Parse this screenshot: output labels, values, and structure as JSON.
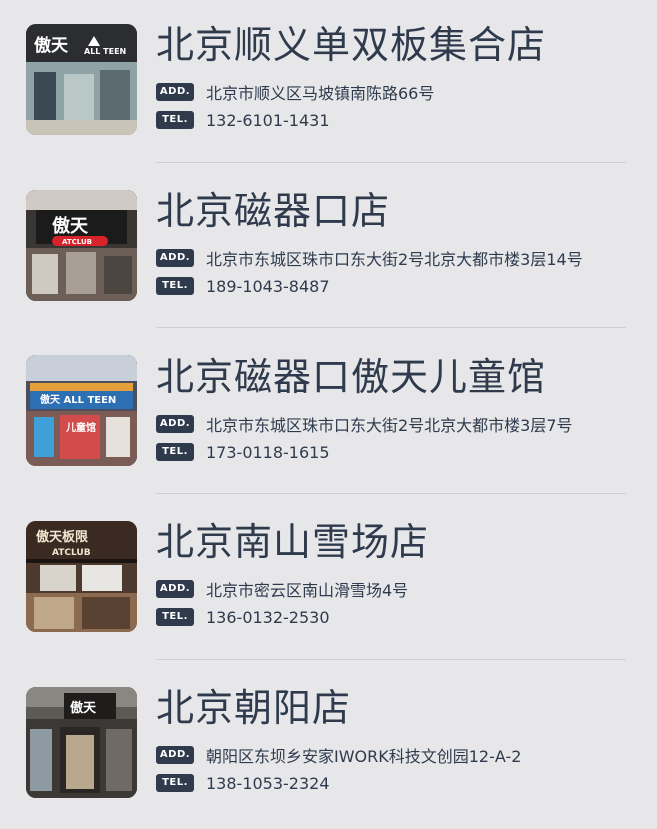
{
  "labels": {
    "address_tag": "ADD.",
    "phone_tag": "TEL."
  },
  "stores": [
    {
      "name": "北京顺义单双板集合店",
      "address": "北京市顺义区马坡镇南陈路66号",
      "phone": "132-6101-1431",
      "sign_text": "傲天",
      "sign_subtext": "ALL TEEN"
    },
    {
      "name": "北京磁器口店",
      "address": "北京市东城区珠市口东大街2号北京大都市楼3层14号",
      "phone": "189-1043-8487",
      "sign_text": "傲天",
      "sign_subtext": "ATCLUB"
    },
    {
      "name": "北京磁器口傲天儿童馆",
      "address": "北京市东城区珠市口东大街2号北京大都市楼3层7号",
      "phone": "173-0118-1615",
      "sign_text": "傲天 ALL TEEN",
      "sign_subtext": "儿童馆"
    },
    {
      "name": "北京南山雪场店",
      "address": "北京市密云区南山滑雪场4号",
      "phone": "136-0132-2530",
      "sign_text": "傲天板限",
      "sign_subtext": "ATCLUB"
    },
    {
      "name": "北京朝阳店",
      "address": "朝阳区东坝乡安家IWORK科技文创园12-A-2",
      "phone": "138-1053-2324",
      "sign_text": "傲天",
      "sign_subtext": ""
    }
  ],
  "colors": {
    "background": "#e7e7e9",
    "text": "#2f3b4d",
    "tag_bg": "#2f3b4d",
    "divider": "#cfcfd3"
  }
}
